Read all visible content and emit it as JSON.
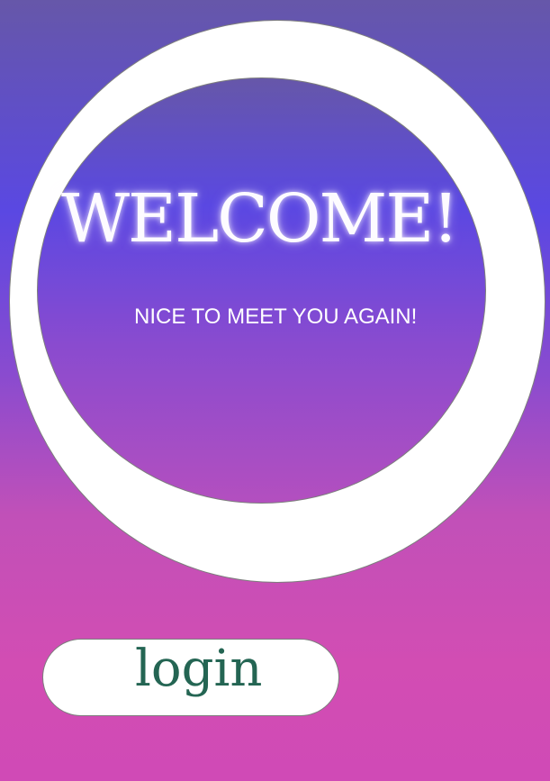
{
  "welcome": {
    "title": "WELCOME!",
    "subtitle": "NICE TO MEET YOU AGAIN!"
  },
  "actions": {
    "login_label": "login"
  },
  "colors": {
    "gradient_top": "#6657a9",
    "gradient_mid": "#5a48e2",
    "gradient_bottom": "#d04ab6",
    "ring": "#ffffff",
    "login_text": "#246553"
  }
}
